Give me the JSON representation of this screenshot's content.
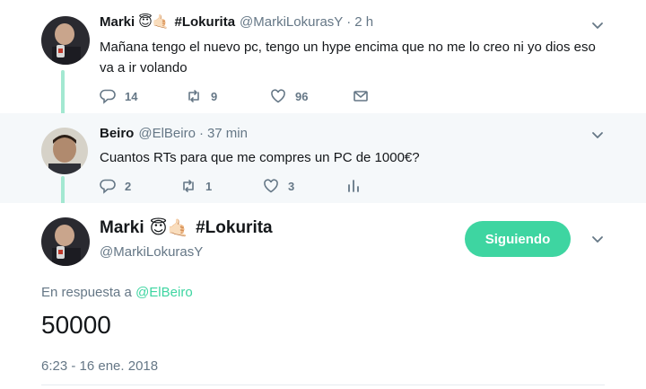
{
  "tweets": [
    {
      "name": "Marki",
      "emojis": "😇🤙🏻",
      "tag": "#Lokurita",
      "handle": "@MarkiLokurasY",
      "time": "2 h",
      "text": "Mañana tengo el nuevo pc, tengo un hype encima que no me lo creo ni yo dios eso va a ir volando",
      "replies": "14",
      "retweets": "9",
      "likes": "96"
    },
    {
      "name": "Beiro",
      "handle": "@ElBeiro",
      "time": "37 min",
      "text": "Cuantos RTs para que me compres un PC de 1000€?",
      "replies": "2",
      "retweets": "1",
      "likes": "3"
    }
  ],
  "main": {
    "name": "Marki",
    "emojis": "😇🤙🏻",
    "tag": "#Lokurita",
    "handle": "@MarkiLokurasY",
    "follow_label": "Siguiendo",
    "reply_prefix": "En respuesta a",
    "reply_handle": "@ElBeiro",
    "text": "50000",
    "date": "6:23 - 16 ene. 2018"
  },
  "colors": {
    "accent": "#3ed5a1",
    "thread_line": "#a3e8d1",
    "muted": "#657786",
    "reply_bg": "#f5f8fa"
  },
  "icons": [
    "reply-icon",
    "retweet-icon",
    "like-icon",
    "direct-message-icon",
    "analytics-icon",
    "chevron-down-icon"
  ]
}
